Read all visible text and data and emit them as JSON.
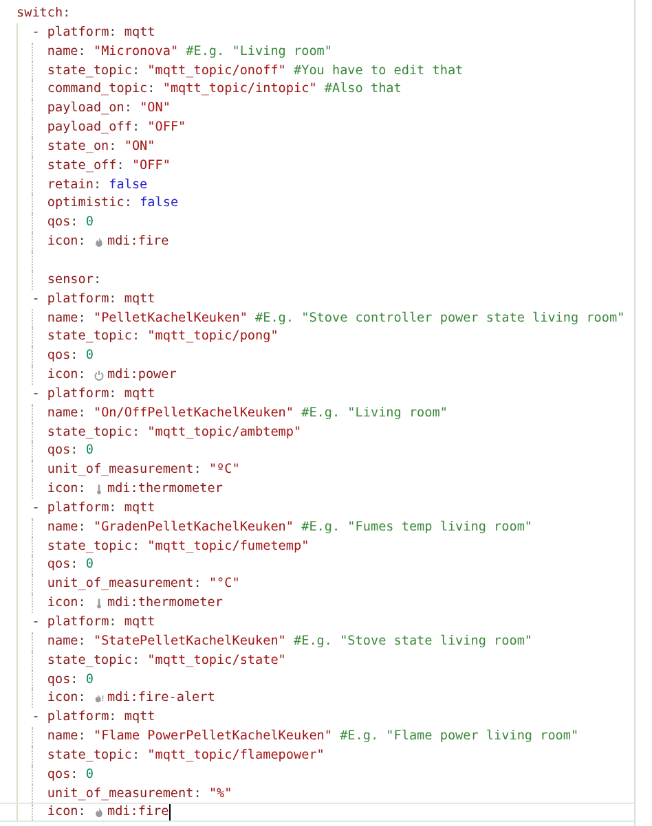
{
  "editor": {
    "lines": [
      {
        "kind": "root",
        "current": false,
        "tokens": [
          {
            "kind": "key",
            "text": "switch"
          },
          {
            "kind": "punct",
            "text": ":"
          }
        ]
      },
      {
        "kind": "item",
        "current": false,
        "tokens": [
          {
            "kind": "dash",
            "text": "-"
          },
          {
            "kind": "key",
            "text": "platform"
          },
          {
            "kind": "punct",
            "text": ":"
          },
          {
            "kind": "plain",
            "text": "mqtt"
          }
        ]
      },
      {
        "kind": "field",
        "current": false,
        "tokens": [
          {
            "kind": "key",
            "text": "name"
          },
          {
            "kind": "punct",
            "text": ":"
          },
          {
            "kind": "string",
            "text": "\"Micronova\""
          },
          {
            "kind": "comment",
            "text": "#E.g. \"Living room\""
          }
        ]
      },
      {
        "kind": "field",
        "current": false,
        "tokens": [
          {
            "kind": "key",
            "text": "state_topic"
          },
          {
            "kind": "punct",
            "text": ":"
          },
          {
            "kind": "string",
            "text": "\"mqtt_topic/onoff\""
          },
          {
            "kind": "comment",
            "text": "#You have to edit that"
          }
        ]
      },
      {
        "kind": "field",
        "current": false,
        "tokens": [
          {
            "kind": "key",
            "text": "command_topic"
          },
          {
            "kind": "punct",
            "text": ":"
          },
          {
            "kind": "string",
            "text": "\"mqtt_topic/intopic\""
          },
          {
            "kind": "comment",
            "text": "#Also that"
          }
        ]
      },
      {
        "kind": "field",
        "current": false,
        "tokens": [
          {
            "kind": "key",
            "text": "payload_on"
          },
          {
            "kind": "punct",
            "text": ":"
          },
          {
            "kind": "string",
            "text": "\"ON\""
          }
        ]
      },
      {
        "kind": "field",
        "current": false,
        "tokens": [
          {
            "kind": "key",
            "text": "payload_off"
          },
          {
            "kind": "punct",
            "text": ":"
          },
          {
            "kind": "string",
            "text": "\"OFF\""
          }
        ]
      },
      {
        "kind": "field",
        "current": false,
        "tokens": [
          {
            "kind": "key",
            "text": "state_on"
          },
          {
            "kind": "punct",
            "text": ":"
          },
          {
            "kind": "string",
            "text": "\"ON\""
          }
        ]
      },
      {
        "kind": "field",
        "current": false,
        "tokens": [
          {
            "kind": "key",
            "text": "state_off"
          },
          {
            "kind": "punct",
            "text": ":"
          },
          {
            "kind": "string",
            "text": "\"OFF\""
          }
        ]
      },
      {
        "kind": "field",
        "current": false,
        "tokens": [
          {
            "kind": "key",
            "text": "retain"
          },
          {
            "kind": "punct",
            "text": ":"
          },
          {
            "kind": "bool",
            "text": "false"
          }
        ]
      },
      {
        "kind": "field",
        "current": false,
        "tokens": [
          {
            "kind": "key",
            "text": "optimistic"
          },
          {
            "kind": "punct",
            "text": ":"
          },
          {
            "kind": "bool",
            "text": "false"
          }
        ]
      },
      {
        "kind": "field",
        "current": false,
        "tokens": [
          {
            "kind": "key",
            "text": "qos"
          },
          {
            "kind": "punct",
            "text": ":"
          },
          {
            "kind": "number",
            "text": "0"
          }
        ]
      },
      {
        "kind": "field",
        "current": false,
        "tokens": [
          {
            "kind": "key",
            "text": "icon"
          },
          {
            "kind": "punct",
            "text": ":"
          },
          {
            "kind": "flame"
          },
          {
            "kind": "plain",
            "text": "mdi:fire"
          }
        ]
      },
      {
        "kind": "blank",
        "current": false
      },
      {
        "kind": "field",
        "current": false,
        "tokens": [
          {
            "kind": "key",
            "text": "sensor"
          },
          {
            "kind": "punct",
            "text": ":"
          }
        ]
      },
      {
        "kind": "item",
        "current": false,
        "tokens": [
          {
            "kind": "dash",
            "text": "-"
          },
          {
            "kind": "key",
            "text": "platform"
          },
          {
            "kind": "punct",
            "text": ":"
          },
          {
            "kind": "plain",
            "text": "mqtt"
          }
        ]
      },
      {
        "kind": "field",
        "current": false,
        "tokens": [
          {
            "kind": "key",
            "text": "name"
          },
          {
            "kind": "punct",
            "text": ":"
          },
          {
            "kind": "string",
            "text": "\"PelletKachelKeuken\""
          },
          {
            "kind": "comment",
            "text": "#E.g. \"Stove controller power state living room\""
          }
        ]
      },
      {
        "kind": "field",
        "current": false,
        "tokens": [
          {
            "kind": "key",
            "text": "state_topic"
          },
          {
            "kind": "punct",
            "text": ":"
          },
          {
            "kind": "string",
            "text": "\"mqtt_topic/pong\""
          }
        ]
      },
      {
        "kind": "field",
        "current": false,
        "tokens": [
          {
            "kind": "key",
            "text": "qos"
          },
          {
            "kind": "punct",
            "text": ":"
          },
          {
            "kind": "number",
            "text": "0"
          }
        ]
      },
      {
        "kind": "field",
        "current": false,
        "tokens": [
          {
            "kind": "key",
            "text": "icon"
          },
          {
            "kind": "punct",
            "text": ":"
          },
          {
            "kind": "power"
          },
          {
            "kind": "plain",
            "text": "mdi:power"
          }
        ]
      },
      {
        "kind": "item",
        "current": false,
        "tokens": [
          {
            "kind": "dash",
            "text": "-"
          },
          {
            "kind": "key",
            "text": "platform"
          },
          {
            "kind": "punct",
            "text": ":"
          },
          {
            "kind": "plain",
            "text": "mqtt"
          }
        ]
      },
      {
        "kind": "field",
        "current": false,
        "tokens": [
          {
            "kind": "key",
            "text": "name"
          },
          {
            "kind": "punct",
            "text": ":"
          },
          {
            "kind": "string",
            "text": "\"On/OffPelletKachelKeuken\""
          },
          {
            "kind": "comment",
            "text": "#E.g. \"Living room\""
          }
        ]
      },
      {
        "kind": "field",
        "current": false,
        "tokens": [
          {
            "kind": "key",
            "text": "state_topic"
          },
          {
            "kind": "punct",
            "text": ":"
          },
          {
            "kind": "string",
            "text": "\"mqtt_topic/ambtemp\""
          }
        ]
      },
      {
        "kind": "field",
        "current": false,
        "tokens": [
          {
            "kind": "key",
            "text": "qos"
          },
          {
            "kind": "punct",
            "text": ":"
          },
          {
            "kind": "number",
            "text": "0"
          }
        ]
      },
      {
        "kind": "field",
        "current": false,
        "tokens": [
          {
            "kind": "key",
            "text": "unit_of_measurement"
          },
          {
            "kind": "punct",
            "text": ":"
          },
          {
            "kind": "string",
            "text": "\"ºC\""
          }
        ]
      },
      {
        "kind": "field",
        "current": false,
        "tokens": [
          {
            "kind": "key",
            "text": "icon"
          },
          {
            "kind": "punct",
            "text": ":"
          },
          {
            "kind": "thermometer"
          },
          {
            "kind": "plain",
            "text": "mdi:thermometer"
          }
        ]
      },
      {
        "kind": "item",
        "current": false,
        "tokens": [
          {
            "kind": "dash",
            "text": "-"
          },
          {
            "kind": "key",
            "text": "platform"
          },
          {
            "kind": "punct",
            "text": ":"
          },
          {
            "kind": "plain",
            "text": "mqtt"
          }
        ]
      },
      {
        "kind": "field",
        "current": false,
        "tokens": [
          {
            "kind": "key",
            "text": "name"
          },
          {
            "kind": "punct",
            "text": ":"
          },
          {
            "kind": "string",
            "text": "\"GradenPelletKachelKeuken\""
          },
          {
            "kind": "comment",
            "text": "#E.g. \"Fumes temp living room\""
          }
        ]
      },
      {
        "kind": "field",
        "current": false,
        "tokens": [
          {
            "kind": "key",
            "text": "state_topic"
          },
          {
            "kind": "punct",
            "text": ":"
          },
          {
            "kind": "string",
            "text": "\"mqtt_topic/fumetemp\""
          }
        ]
      },
      {
        "kind": "field",
        "current": false,
        "tokens": [
          {
            "kind": "key",
            "text": "qos"
          },
          {
            "kind": "punct",
            "text": ":"
          },
          {
            "kind": "number",
            "text": "0"
          }
        ]
      },
      {
        "kind": "field",
        "current": false,
        "tokens": [
          {
            "kind": "key",
            "text": "unit_of_measurement"
          },
          {
            "kind": "punct",
            "text": ":"
          },
          {
            "kind": "string",
            "text": "\"°C\""
          }
        ]
      },
      {
        "kind": "field",
        "current": false,
        "tokens": [
          {
            "kind": "key",
            "text": "icon"
          },
          {
            "kind": "punct",
            "text": ":"
          },
          {
            "kind": "thermometer"
          },
          {
            "kind": "plain",
            "text": "mdi:thermometer"
          }
        ]
      },
      {
        "kind": "item",
        "current": false,
        "tokens": [
          {
            "kind": "dash",
            "text": "-"
          },
          {
            "kind": "key",
            "text": "platform"
          },
          {
            "kind": "punct",
            "text": ":"
          },
          {
            "kind": "plain",
            "text": "mqtt"
          }
        ]
      },
      {
        "kind": "field",
        "current": false,
        "tokens": [
          {
            "kind": "key",
            "text": "name"
          },
          {
            "kind": "punct",
            "text": ":"
          },
          {
            "kind": "string",
            "text": "\"StatePelletKachelKeuken\""
          },
          {
            "kind": "comment",
            "text": "#E.g. \"Stove state living room\""
          }
        ]
      },
      {
        "kind": "field",
        "current": false,
        "tokens": [
          {
            "kind": "key",
            "text": "state_topic"
          },
          {
            "kind": "punct",
            "text": ":"
          },
          {
            "kind": "string",
            "text": "\"mqtt_topic/state\""
          }
        ]
      },
      {
        "kind": "field",
        "current": false,
        "tokens": [
          {
            "kind": "key",
            "text": "qos"
          },
          {
            "kind": "punct",
            "text": ":"
          },
          {
            "kind": "number",
            "text": "0"
          }
        ]
      },
      {
        "kind": "field",
        "current": false,
        "tokens": [
          {
            "kind": "key",
            "text": "icon"
          },
          {
            "kind": "punct",
            "text": ":"
          },
          {
            "kind": "flame_alert"
          },
          {
            "kind": "plain",
            "text": "mdi:fire-alert"
          }
        ]
      },
      {
        "kind": "item",
        "current": false,
        "tokens": [
          {
            "kind": "dash",
            "text": "-"
          },
          {
            "kind": "key",
            "text": "platform"
          },
          {
            "kind": "punct",
            "text": ":"
          },
          {
            "kind": "plain",
            "text": "mqtt"
          }
        ]
      },
      {
        "kind": "field",
        "current": false,
        "tokens": [
          {
            "kind": "key",
            "text": "name"
          },
          {
            "kind": "punct",
            "text": ":"
          },
          {
            "kind": "string",
            "text": "\"Flame PowerPelletKachelKeuken\""
          },
          {
            "kind": "comment",
            "text": "#E.g. \"Flame power living room\""
          }
        ]
      },
      {
        "kind": "field",
        "current": false,
        "tokens": [
          {
            "kind": "key",
            "text": "state_topic"
          },
          {
            "kind": "punct",
            "text": ":"
          },
          {
            "kind": "string",
            "text": "\"mqtt_topic/flamepower\""
          }
        ]
      },
      {
        "kind": "field",
        "current": false,
        "tokens": [
          {
            "kind": "key",
            "text": "qos"
          },
          {
            "kind": "punct",
            "text": ":"
          },
          {
            "kind": "number",
            "text": "0"
          }
        ]
      },
      {
        "kind": "field",
        "current": false,
        "tokens": [
          {
            "kind": "key",
            "text": "unit_of_measurement"
          },
          {
            "kind": "punct",
            "text": ":"
          },
          {
            "kind": "string",
            "text": "\"%\""
          }
        ]
      },
      {
        "kind": "field",
        "current": true,
        "tokens": [
          {
            "kind": "key",
            "text": "icon"
          },
          {
            "kind": "punct",
            "text": ":"
          },
          {
            "kind": "flame"
          },
          {
            "kind": "plain",
            "text": "mdi:fire"
          }
        ]
      }
    ]
  }
}
